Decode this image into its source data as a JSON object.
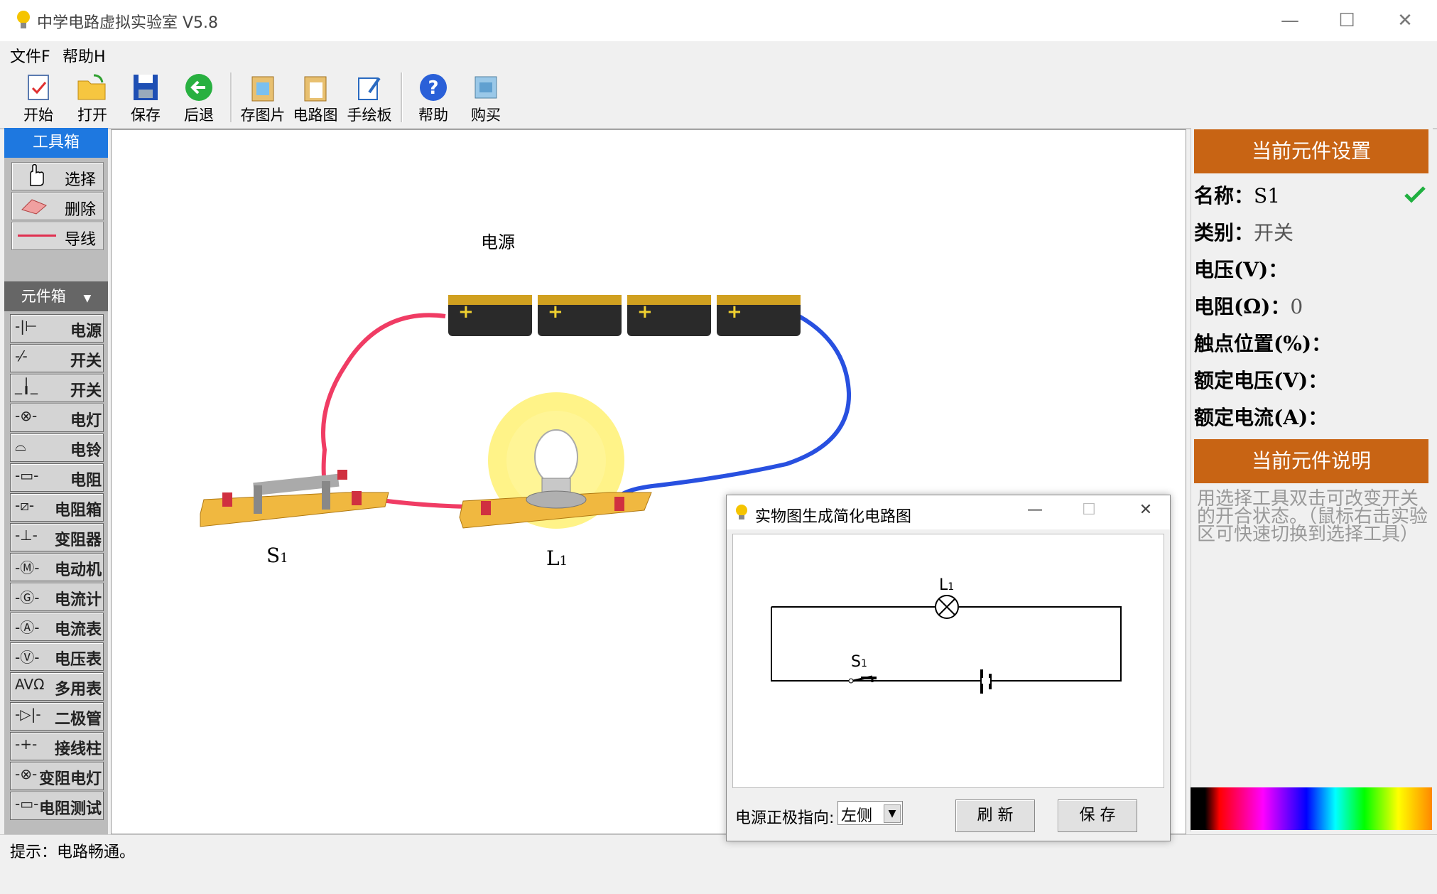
{
  "window": {
    "title": "中学电路虚拟实验室 V5.8",
    "min": "—",
    "max": "☐",
    "close": "✕"
  },
  "menu": [
    "文件F",
    "帮助H"
  ],
  "toolbar": {
    "start": "开始",
    "open": "打开",
    "save": "保存",
    "back": "后退",
    "save_image": "存图片",
    "circuit_diagram": "电路图",
    "drawing_board": "手绘板",
    "help": "帮助",
    "buy": "购买"
  },
  "toolbox": {
    "title": "工具箱",
    "select": "选择",
    "delete": "删除",
    "wire": "导线"
  },
  "components": {
    "title": "元件箱",
    "items": [
      "电源",
      "开关",
      "开关",
      "电灯",
      "电铃",
      "电阻",
      "电阻箱",
      "变阻器",
      "电动机",
      "电流计",
      "电流表",
      "电压表",
      "多用表",
      "二极管",
      "接线柱",
      "变阻电灯",
      "电阻测试"
    ],
    "symbols": [
      "-|⊢",
      "-⁄-",
      "_╽_",
      "-⊗-",
      "⌓",
      "-▭-",
      "-⧄-",
      "-⊥-",
      "-Ⓜ-",
      "-Ⓖ-",
      "-Ⓐ-",
      "-Ⓥ-",
      "AVΩ",
      "-▷|-",
      "-+-",
      "-⊗-",
      "-▭-"
    ]
  },
  "circuit": {
    "power_label": "电源",
    "switch_label": "S",
    "switch_sub": "1",
    "lamp_label": "L",
    "lamp_sub": "1"
  },
  "properties": {
    "title": "当前元件设置",
    "name_label": "名称：",
    "name_value": "S1",
    "type_label": "类别：",
    "type_value": "开关",
    "voltage_label": "电压(V)：",
    "voltage_value": "",
    "resistance_label": "电阻(Ω)：",
    "resistance_value": "0",
    "contact_label": "触点位置(%)：",
    "rated_voltage_label": "额定电压(V)：",
    "rated_current_label": "额定电流(A)：",
    "desc_title": "当前元件说明",
    "desc": "用选择工具双击可改变开关的开合状态。（鼠标右击实验区可快速切换到选择工具）"
  },
  "status": "提示：电路畅通。",
  "dialog": {
    "title": "实物图生成简化电路图",
    "lamp_label": "L",
    "lamp_sub": "1",
    "switch_label": "S",
    "switch_sub": "1",
    "polarity_label": "电源正极指向:",
    "polarity_value": "左侧",
    "refresh": "刷 新",
    "save": "保 存"
  },
  "colors": {
    "accent_orange": "#c86414",
    "toolbox_blue": "#1e78e0",
    "wire_red": "#f03c64",
    "wire_blue": "#2850e0"
  }
}
